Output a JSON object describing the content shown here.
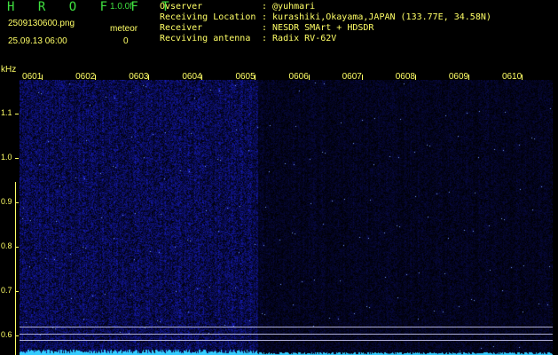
{
  "app": {
    "title": "H R O F F T",
    "version": "1.0.0f"
  },
  "capture": {
    "file_name": "2509130600.png",
    "timestamp": "25.09.13 06:00",
    "meteor_label": "meteor",
    "meteor_count": "0"
  },
  "info": [
    {
      "key": "Ovserver",
      "value": ": @yuhmari"
    },
    {
      "key": "Receiving Location",
      "value": ": kurashiki,Okayama,JAPAN (133.77E, 34.58N)"
    },
    {
      "key": "Receiver",
      "value": ": NESDR SMArt + HDSDR"
    },
    {
      "key": "Recviving antenna",
      "value": ": Radix RV-62V"
    }
  ],
  "chart_data": {
    "type": "heatmap",
    "ylabel": "kHz",
    "yticks": [
      "1.1",
      "1.0",
      "0.9",
      "0.8",
      "0.7",
      "0.6"
    ],
    "y_values": [
      1.1,
      1.0,
      0.9,
      0.8,
      0.7,
      0.6
    ],
    "ylim": [
      0.6,
      1.15
    ],
    "xticks": [
      "0601",
      "0602",
      "0603",
      "0604",
      "0605",
      "0606",
      "0607",
      "0608",
      "0609",
      "0610"
    ],
    "x_values": [
      1,
      2,
      3,
      4,
      5,
      6,
      7,
      8,
      9,
      10
    ],
    "xlim": [
      0.6,
      10.6
    ],
    "bright_region_end_minute": 5,
    "reference_lines_khz": [
      0.62,
      0.605,
      0.59
    ],
    "colors": {
      "background": "#000000",
      "signal_noise": "#2020a0",
      "signal_level": "#33ccff",
      "axis_text": "#ffff66",
      "title_green": "#3fe03f"
    }
  }
}
